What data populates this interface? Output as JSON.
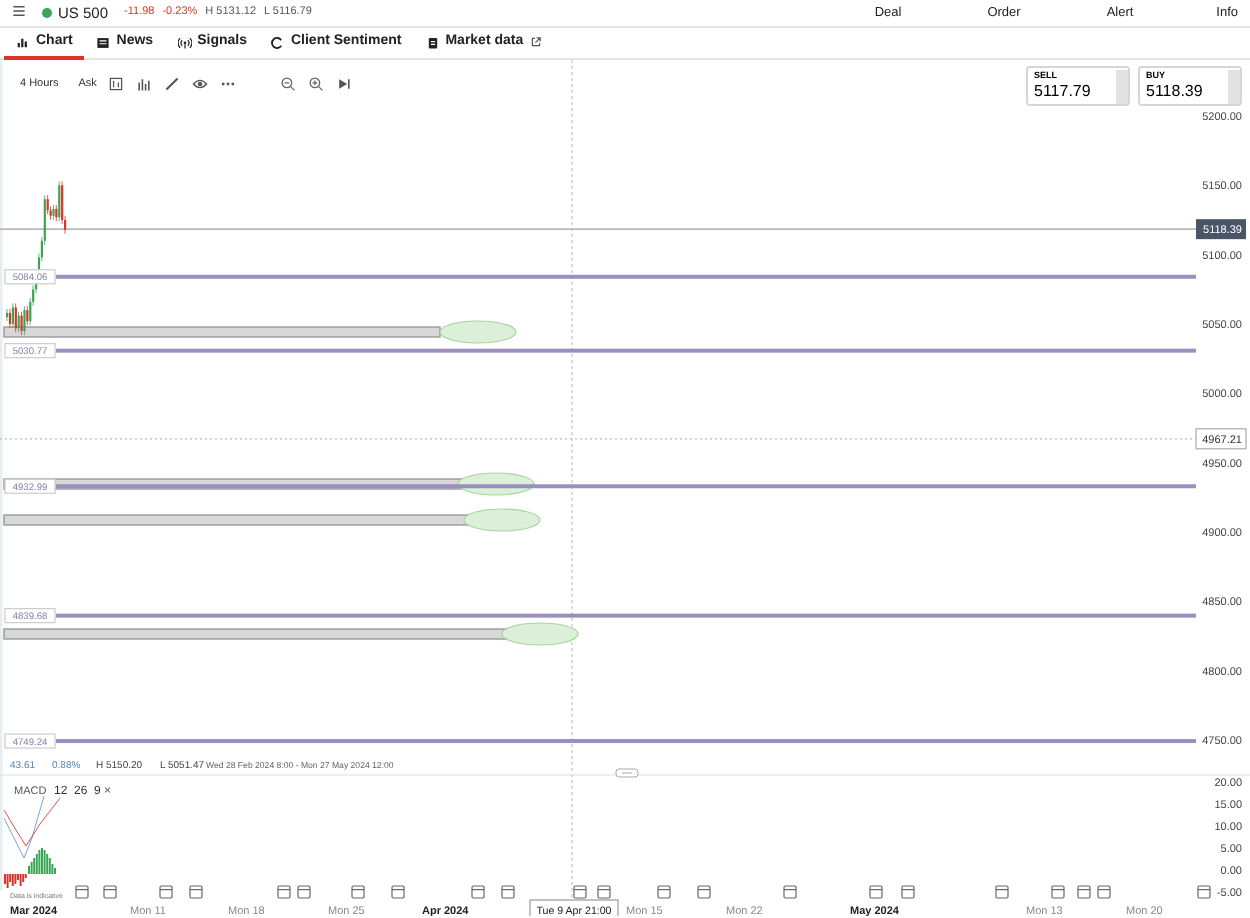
{
  "header": {
    "instrument": {
      "name": "US 500",
      "color": "#3aa655"
    },
    "change": "-11.98",
    "change_pct": "-0.23%",
    "high": "H 5131.12",
    "low": "L 5116.79",
    "actions": [
      "Deal",
      "Order",
      "Alert",
      "Info"
    ]
  },
  "tabs": [
    {
      "label": "Chart",
      "kind": "chart",
      "selected": true,
      "external": false
    },
    {
      "label": "News",
      "kind": "news",
      "selected": false,
      "external": false
    },
    {
      "label": "Signals",
      "kind": "signals",
      "selected": false,
      "external": false
    },
    {
      "label": "Client Sentiment",
      "kind": "sentiment",
      "selected": false,
      "external": false
    },
    {
      "label": "Market data",
      "kind": "market",
      "selected": false,
      "external": true
    }
  ],
  "toolbar": {
    "timeframe": "4 Hours",
    "price_type": "Ask"
  },
  "quote": {
    "sell": {
      "label": "SELL",
      "price": "5117.79"
    },
    "buy": {
      "label": "BUY",
      "price": "5118.39"
    }
  },
  "price_axis": {
    "ticks": [
      "5200.00",
      "5150.00",
      "5100.00",
      "5050.00",
      "5000.00",
      "4950.00",
      "4900.00",
      "4850.00",
      "4800.00",
      "4750.00"
    ],
    "current_price": "5118.39",
    "crosshair_price": "4967.21"
  },
  "levels": [
    {
      "label": "5084.06"
    },
    {
      "label": "5030.77"
    },
    {
      "label": "4932.99"
    },
    {
      "label": "4839.68"
    },
    {
      "label": "4749.24"
    }
  ],
  "stats": {
    "change": "43.61",
    "change_pct": "0.88%",
    "high": "H 5150.20",
    "low": "L 5051.47",
    "range": "Wed 28 Feb 2024 8:00 - Mon 27 May 2024 12:00"
  },
  "macd": {
    "label": "MACD",
    "params": [
      "12",
      "26",
      "9"
    ],
    "close": "×",
    "ticks": [
      "20.00",
      "15.00",
      "10.00",
      "5.00",
      "0.00",
      "-5.00"
    ]
  },
  "note": "Data is indicative",
  "time_axis": [
    {
      "label": "Mar 2024",
      "kind": "month"
    },
    {
      "label": "Mon 11",
      "kind": "day"
    },
    {
      "label": "Mon 18",
      "kind": "day"
    },
    {
      "label": "Mon 25",
      "kind": "day"
    },
    {
      "label": "Apr 2024",
      "kind": "month"
    },
    {
      "label": "Tue 9 Apr 21:00",
      "kind": "cursor"
    },
    {
      "label": "Mon 15",
      "kind": "day"
    },
    {
      "label": "Mon 22",
      "kind": "day"
    },
    {
      "label": "May 2024",
      "kind": "month"
    },
    {
      "label": "Mon 13",
      "kind": "day"
    },
    {
      "label": "Mon 20",
      "kind": "day"
    }
  ]
}
